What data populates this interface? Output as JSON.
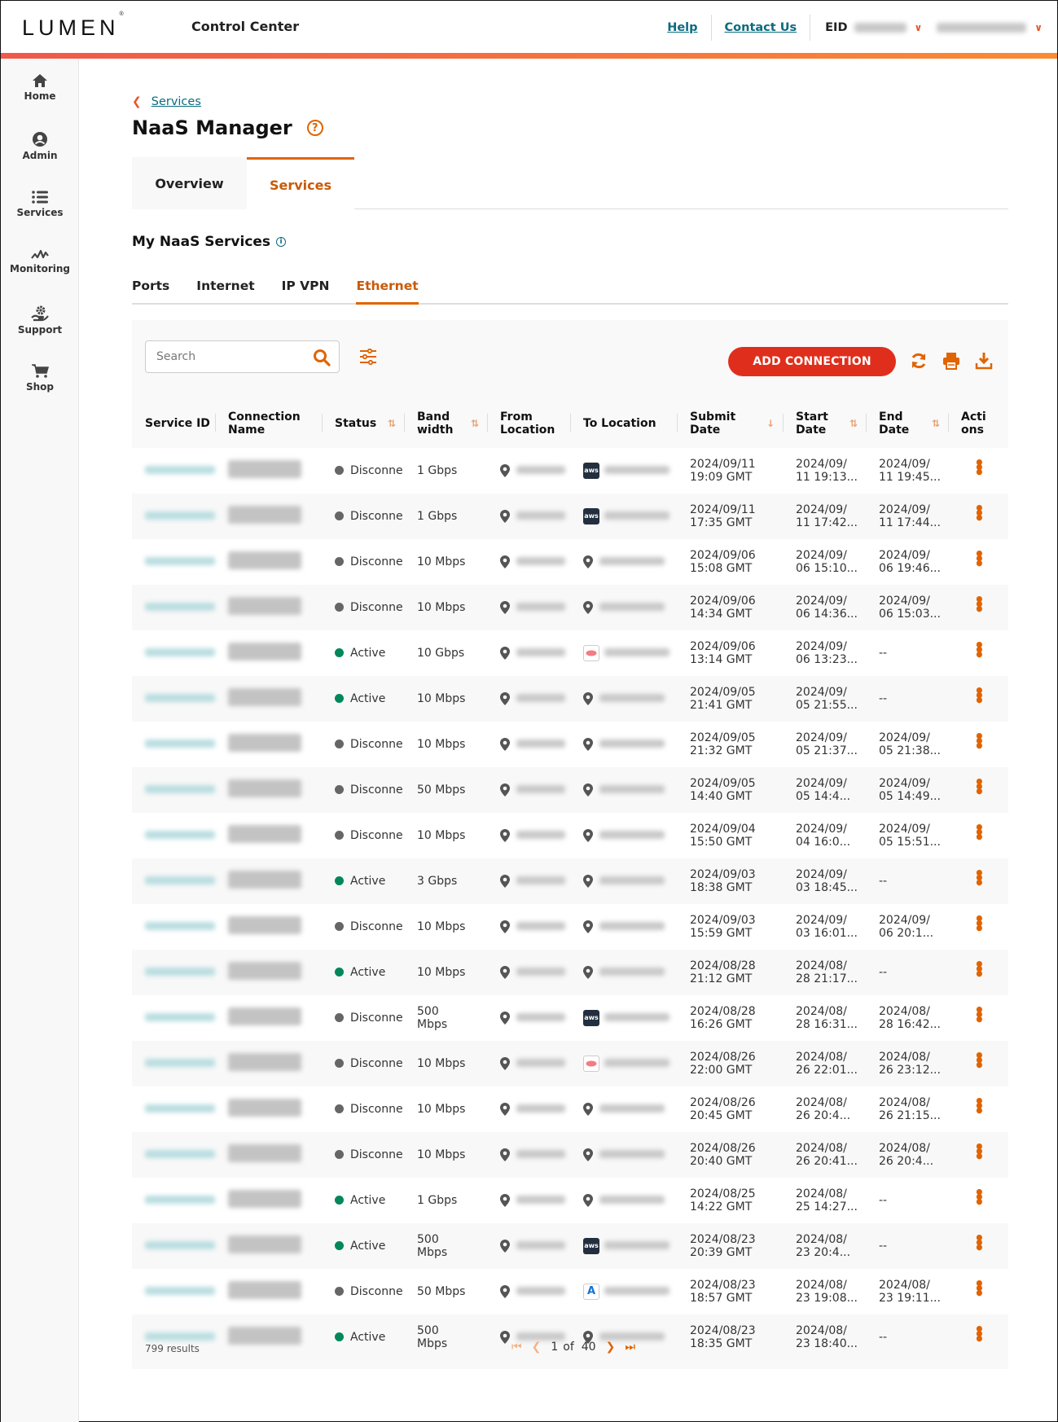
{
  "header": {
    "logo": "LUMEN",
    "app_title": "Control Center",
    "links": [
      "Help",
      "Contact Us"
    ],
    "eid_label": "EID"
  },
  "sidebar": {
    "items": [
      {
        "label": "Home",
        "icon": "home-icon"
      },
      {
        "label": "Admin",
        "icon": "user-circle-icon"
      },
      {
        "label": "Services",
        "icon": "list-icon"
      },
      {
        "label": "Monitoring",
        "icon": "pulse-icon"
      },
      {
        "label": "Support",
        "icon": "support-icon"
      },
      {
        "label": "Shop",
        "icon": "cart-icon"
      }
    ]
  },
  "page": {
    "breadcrumb": "Services",
    "title": "NaaS Manager",
    "tabs": [
      "Overview",
      "Services"
    ],
    "active_tab": "Services",
    "section_title": "My NaaS Services",
    "subtabs": [
      "Ports",
      "Internet",
      "IP VPN",
      "Ethernet"
    ],
    "active_subtab": "Ethernet"
  },
  "toolbar": {
    "search_placeholder": "Search",
    "add_label": "ADD CONNECTION"
  },
  "table": {
    "columns": [
      "Service ID",
      "Connection Name",
      "Status",
      "Band width",
      "From Location",
      "To Location",
      "Submit Date",
      "Start Date",
      "End Date",
      "Actions"
    ],
    "rows": [
      {
        "status": "Disconne",
        "bandwidth": "1 Gbps",
        "to_provider": "aws",
        "submit": "2024/09/11 19:09 GMT",
        "start": "2024/09/ 11 19:13...",
        "end": "2024/09/ 11 19:45..."
      },
      {
        "status": "Disconne",
        "bandwidth": "1 Gbps",
        "to_provider": "aws",
        "submit": "2024/09/11 17:35 GMT",
        "start": "2024/09/ 11 17:42...",
        "end": "2024/09/ 11 17:44..."
      },
      {
        "status": "Disconne",
        "bandwidth": "10 Mbps",
        "to_provider": "pin",
        "submit": "2024/09/06 15:08 GMT",
        "start": "2024/09/ 06 15:10...",
        "end": "2024/09/ 06 19:46..."
      },
      {
        "status": "Disconne",
        "bandwidth": "10 Mbps",
        "to_provider": "pin",
        "submit": "2024/09/06 14:34 GMT",
        "start": "2024/09/ 06 14:36...",
        "end": "2024/09/ 06 15:03..."
      },
      {
        "status": "Active",
        "bandwidth": "10 Gbps",
        "to_provider": "oracle",
        "submit": "2024/09/06 13:14 GMT",
        "start": "2024/09/ 06 13:23...",
        "end": "--"
      },
      {
        "status": "Active",
        "bandwidth": "10 Mbps",
        "to_provider": "pin",
        "submit": "2024/09/05 21:41 GMT",
        "start": "2024/09/ 05 21:55...",
        "end": "--"
      },
      {
        "status": "Disconne",
        "bandwidth": "10 Mbps",
        "to_provider": "pin",
        "submit": "2024/09/05 21:32 GMT",
        "start": "2024/09/ 05 21:37...",
        "end": "2024/09/ 05 21:38..."
      },
      {
        "status": "Disconne",
        "bandwidth": "50 Mbps",
        "to_provider": "pin",
        "submit": "2024/09/05 14:40 GMT",
        "start": "2024/09/ 05 14:4...",
        "end": "2024/09/ 05 14:49..."
      },
      {
        "status": "Disconne",
        "bandwidth": "10 Mbps",
        "to_provider": "pin",
        "submit": "2024/09/04 15:50 GMT",
        "start": "2024/09/ 04 16:0...",
        "end": "2024/09/ 05 15:51..."
      },
      {
        "status": "Active",
        "bandwidth": "3 Gbps",
        "to_provider": "pin",
        "submit": "2024/09/03 18:38 GMT",
        "start": "2024/09/ 03 18:45...",
        "end": "--"
      },
      {
        "status": "Disconne",
        "bandwidth": "10 Mbps",
        "to_provider": "pin",
        "submit": "2024/09/03 15:59 GMT",
        "start": "2024/09/ 03 16:01...",
        "end": "2024/09/ 06 20:1..."
      },
      {
        "status": "Active",
        "bandwidth": "10 Mbps",
        "to_provider": "pin",
        "submit": "2024/08/28 21:12 GMT",
        "start": "2024/08/ 28 21:17...",
        "end": "--"
      },
      {
        "status": "Disconne",
        "bandwidth": "500 Mbps",
        "to_provider": "aws",
        "submit": "2024/08/28 16:26 GMT",
        "start": "2024/08/ 28 16:31...",
        "end": "2024/08/ 28 16:42..."
      },
      {
        "status": "Disconne",
        "bandwidth": "10 Mbps",
        "to_provider": "oracle",
        "submit": "2024/08/26 22:00 GMT",
        "start": "2024/08/ 26 22:01...",
        "end": "2024/08/ 26 23:12..."
      },
      {
        "status": "Disconne",
        "bandwidth": "10 Mbps",
        "to_provider": "pin",
        "submit": "2024/08/26 20:45 GMT",
        "start": "2024/08/ 26 20:4...",
        "end": "2024/08/ 26 21:15..."
      },
      {
        "status": "Disconne",
        "bandwidth": "10 Mbps",
        "to_provider": "pin",
        "submit": "2024/08/26 20:40 GMT",
        "start": "2024/08/ 26 20:41...",
        "end": "2024/08/ 26 20:4..."
      },
      {
        "status": "Active",
        "bandwidth": "1 Gbps",
        "to_provider": "pin",
        "submit": "2024/08/25 14:22 GMT",
        "start": "2024/08/ 25 14:27...",
        "end": "--"
      },
      {
        "status": "Active",
        "bandwidth": "500 Mbps",
        "to_provider": "aws",
        "submit": "2024/08/23 20:39 GMT",
        "start": "2024/08/ 23 20:4...",
        "end": "--"
      },
      {
        "status": "Disconne",
        "bandwidth": "50 Mbps",
        "to_provider": "azure",
        "submit": "2024/08/23 18:57 GMT",
        "start": "2024/08/ 23 19:08...",
        "end": "2024/08/ 23 19:11..."
      },
      {
        "status": "Active",
        "bandwidth": "500 Mbps",
        "to_provider": "pin",
        "submit": "2024/08/23 18:35 GMT",
        "start": "2024/08/ 23 18:40...",
        "end": "--"
      }
    ]
  },
  "footer": {
    "results": "799 results",
    "page_current": "1",
    "page_of": "of",
    "page_total": "40"
  },
  "colors": {
    "accent": "#e06400",
    "button": "#df2f1c",
    "active": "#00875a",
    "disconnected": "#666666",
    "link": "#0a6b80"
  }
}
